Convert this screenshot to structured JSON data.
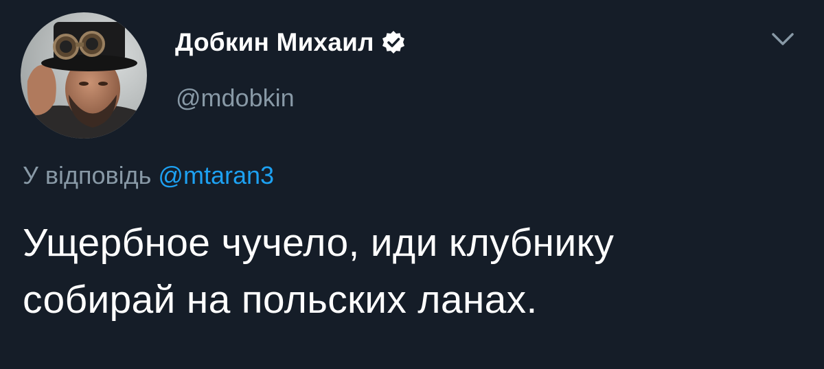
{
  "author": {
    "display_name": "Добкин Михаил",
    "handle": "@mdobkin",
    "verified": true
  },
  "reply": {
    "prefix": "У відповідь ",
    "mention": "@mtaran3"
  },
  "tweet": {
    "line1": "Ущербное чучело, иди клубнику",
    "line2": "собирай на польских ланах."
  },
  "icons": {
    "verified": "verified-badge-icon",
    "menu": "chevron-down-icon"
  },
  "colors": {
    "background": "#151d28",
    "primary_text": "#ffffff",
    "secondary_text": "#8899a6",
    "link": "#1da1f2"
  }
}
